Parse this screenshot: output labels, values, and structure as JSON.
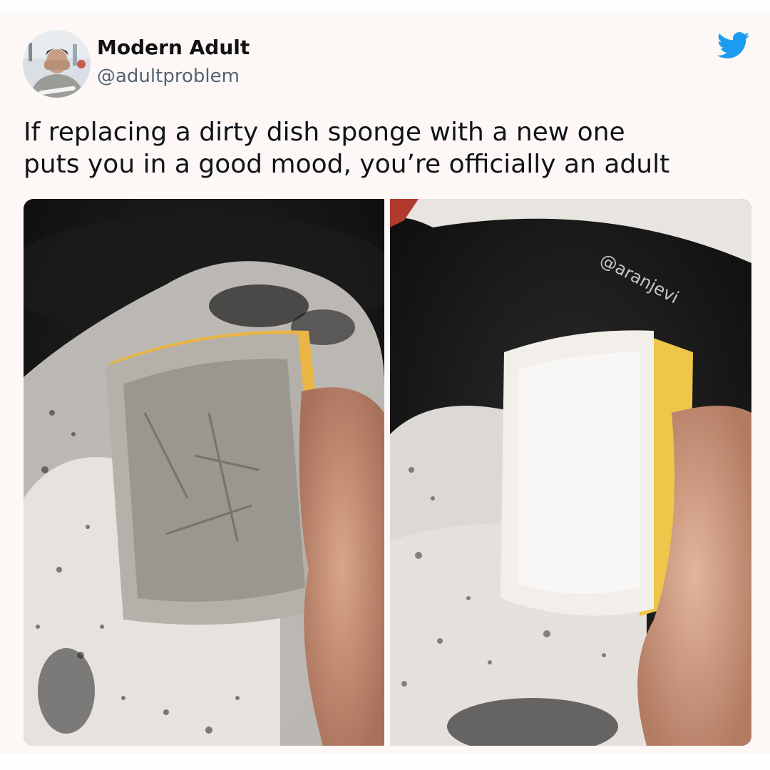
{
  "tweet": {
    "display_name": "Modern Adult",
    "handle": "@adultproblem",
    "text_line1": "If replacing a dirty dish sponge with a new one",
    "text_line2": "puts you in a good mood, you’re officially an adult"
  },
  "media": {
    "watermark": "@aranjevi",
    "left_image": "dirty-sponge-photo",
    "right_image": "new-sponge-photo"
  },
  "icons": {
    "brand": "twitter-bird-icon"
  },
  "colors": {
    "twitter_blue": "#1d9bf0",
    "card_bg": "#fdf8f6",
    "handle_gray": "#536471"
  }
}
